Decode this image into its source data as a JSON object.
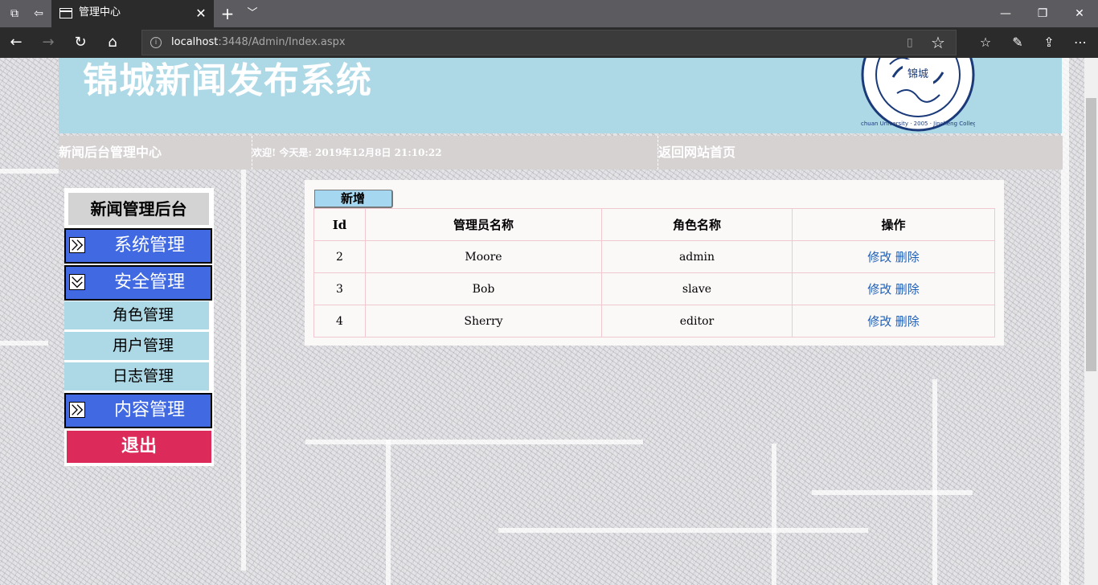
{
  "browser": {
    "tab_title": "管理中心",
    "address_host": "localhost",
    "address_rest": ":3448/Admin/Index.aspx"
  },
  "header": {
    "site_title": "锦城新闻发布系统",
    "logo_text_cn": "锦城",
    "logo_ring_text": "Sichuan University · 2005 · Jincheng College"
  },
  "infobar": {
    "admin_center": "新闻后台管理中心",
    "welcome": "欢迎! 今天是: 2019年12月8日 21:10:22",
    "home_link": "返回网站首页"
  },
  "sidebar": {
    "title": "新闻管理后台",
    "menus": [
      {
        "label": "系统管理",
        "icon": "expand-arrow-icon"
      },
      {
        "label": "安全管理",
        "icon": "collapse-arrow-icon"
      },
      {
        "label": "内容管理",
        "icon": "expand-arrow-icon"
      }
    ],
    "security_items": [
      "角色管理",
      "用户管理",
      "日志管理"
    ],
    "logout": "退出"
  },
  "content": {
    "add_button": "新增",
    "columns": [
      "Id",
      "管理员名称",
      "角色名称",
      "操作"
    ],
    "rows": [
      {
        "id": "2",
        "name": "Moore",
        "role": "admin",
        "edit": "修改",
        "delete": "删除"
      },
      {
        "id": "3",
        "name": "Bob",
        "role": "slave",
        "edit": "修改",
        "delete": "删除"
      },
      {
        "id": "4",
        "name": "Sherry",
        "role": "editor",
        "edit": "修改",
        "delete": "删除"
      }
    ]
  },
  "colors": {
    "header_bg": "#add8e6",
    "menu_blue": "#4169e1",
    "logout_red": "#dc2a5a",
    "link_blue": "#1f5fb4"
  }
}
